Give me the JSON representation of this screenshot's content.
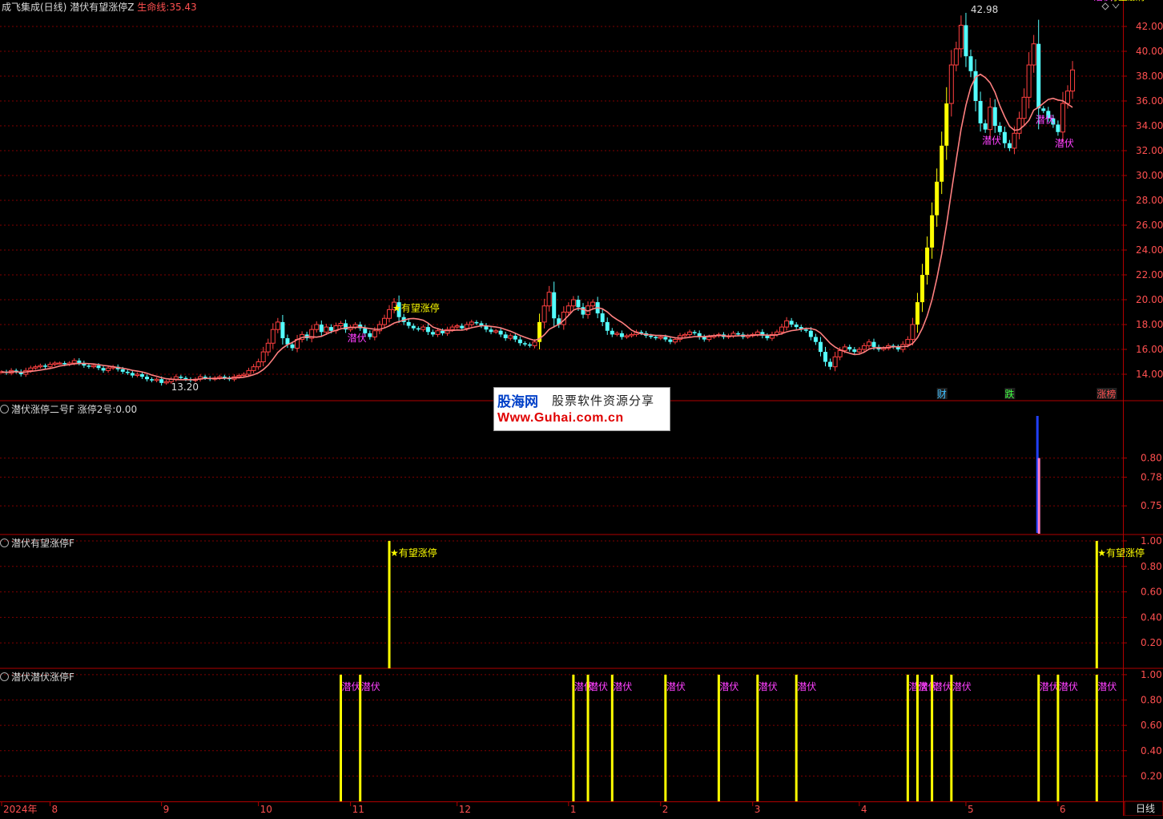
{
  "panel1": {
    "title": "成飞集成(日线)",
    "indicator": "潜伏有望涨停Z",
    "line_label": "生命线:",
    "line_value": "35.43",
    "high_label": "42.98",
    "low_label": "13.20",
    "signal_star": "有望涨停",
    "signal_latent": "潜伏",
    "mark_cai": "财",
    "mark_die": "跌",
    "mark_zhangbang": "涨榜"
  },
  "panel2": {
    "title": "潜伏涨停二号F",
    "value_label": "涨停2号:",
    "value": "0.00"
  },
  "panel3": {
    "title": "潜伏有望涨停F",
    "signal": "有望涨停"
  },
  "panel4": {
    "title": "潜伏潜伏涨停F",
    "signal": "潜伏"
  },
  "xaxis": {
    "labels": [
      "2024年",
      "8",
      "9",
      "10",
      "11",
      "12",
      "1",
      "2",
      "3",
      "4",
      "5",
      "6"
    ]
  },
  "period_label": "日线",
  "watermark": {
    "brand": "股海网",
    "slogan": "股票软件资源分享",
    "url": "Www.Guhai.com.cn"
  },
  "colors": {
    "up": "#ff4040",
    "down": "#54ffff",
    "signal": "#ffff00",
    "latent": "#ff40ff",
    "lifeline": "#ff8080",
    "grid": "#800000"
  },
  "chart_data": [
    {
      "type": "line",
      "name": "price",
      "ylim": [
        13,
        43
      ],
      "yticks": [
        "14.00",
        "16.00",
        "18.00",
        "20.00",
        "22.00",
        "24.00",
        "26.00",
        "28.00",
        "30.00",
        "32.00",
        "34.00",
        "36.00",
        "38.00",
        "40.00",
        "42.00"
      ],
      "close": [
        14.2,
        14.1,
        14.3,
        14.2,
        14.0,
        14.3,
        14.5,
        14.6,
        14.7,
        14.6,
        14.8,
        14.9,
        14.9,
        14.8,
        14.9,
        15.1,
        14.9,
        14.7,
        14.6,
        14.7,
        14.5,
        14.3,
        14.5,
        14.6,
        14.4,
        14.2,
        14.1,
        13.9,
        14.0,
        13.8,
        13.6,
        13.5,
        13.6,
        13.3,
        13.4,
        13.6,
        13.8,
        13.7,
        13.6,
        13.5,
        13.6,
        13.8,
        13.7,
        13.6,
        13.7,
        13.8,
        13.7,
        13.6,
        13.8,
        13.9,
        14.0,
        14.3,
        14.6,
        15.0,
        15.8,
        16.5,
        17.6,
        18.2,
        16.9,
        16.4,
        16.1,
        16.8,
        17.2,
        16.9,
        17.6,
        18.0,
        17.4,
        17.8,
        17.5,
        17.9,
        18.1,
        17.6,
        17.8,
        18.0,
        17.7,
        17.3,
        17.0,
        17.5,
        18.0,
        18.5,
        19.2,
        19.8,
        18.6,
        18.2,
        17.9,
        17.7,
        17.6,
        17.8,
        17.4,
        17.2,
        17.5,
        17.3,
        17.6,
        17.8,
        17.9,
        17.7,
        18.0,
        18.2,
        18.1,
        17.9,
        17.6,
        17.4,
        17.5,
        17.2,
        16.9,
        17.1,
        16.8,
        16.5,
        16.4,
        16.3,
        16.6,
        18.2,
        19.5,
        20.6,
        18.5,
        18.0,
        19.0,
        19.5,
        20.0,
        19.4,
        18.8,
        19.5,
        19.8,
        18.9,
        18.2,
        17.5,
        17.2,
        17.3,
        17.0,
        17.1,
        17.2,
        17.4,
        17.3,
        17.1,
        17.0,
        16.9,
        17.0,
        16.8,
        16.6,
        16.8,
        17.1,
        17.2,
        17.4,
        17.3,
        17.0,
        16.8,
        17.0,
        17.1,
        17.2,
        17.0,
        17.1,
        17.3,
        17.2,
        17.0,
        17.1,
        17.2,
        17.4,
        17.1,
        16.9,
        17.2,
        17.4,
        17.8,
        18.3,
        18.0,
        17.8,
        17.6,
        17.5,
        17.0,
        16.6,
        15.8,
        15.0,
        14.6,
        15.4,
        15.9,
        16.2,
        16.0,
        15.8,
        16.0,
        16.3,
        16.6,
        16.2,
        16.0,
        16.1,
        16.3,
        16.2,
        16.0,
        16.4,
        16.8,
        18.0,
        19.8,
        22.0,
        24.2,
        26.8,
        29.5,
        32.4,
        35.8,
        38.9,
        40.2,
        42.1,
        39.6,
        38.4,
        36.0,
        34.2,
        33.7,
        35.5,
        34.0,
        33.5,
        32.6,
        32.2,
        33.4,
        34.6,
        36.3,
        38.9,
        40.6,
        35.4,
        35.2,
        34.6,
        34.1,
        33.5,
        35.8,
        36.8,
        38.5
      ]
    },
    {
      "type": "bar",
      "name": "涨停2号",
      "ylim": [
        0.72,
        0.86
      ],
      "yticks": [
        "0.75",
        "0.78",
        "0.80"
      ],
      "x": [
        214
      ],
      "values": [
        0.8
      ]
    },
    {
      "type": "bar",
      "name": "有望涨停",
      "ylim": [
        0,
        1.05
      ],
      "yticks": [
        "0.20",
        "0.40",
        "0.60",
        "0.80",
        "1.00"
      ],
      "x": [
        80,
        226
      ],
      "values": [
        1.0,
        1.0
      ]
    },
    {
      "type": "bar",
      "name": "潜伏",
      "ylim": [
        0,
        1.05
      ],
      "yticks": [
        "0.20",
        "0.40",
        "0.60",
        "0.80",
        "1.00"
      ],
      "x": [
        70,
        74,
        118,
        121,
        126,
        137,
        148,
        156,
        164,
        187,
        189,
        192,
        196,
        214,
        218,
        226
      ],
      "values": [
        1,
        1,
        1,
        1,
        1,
        1,
        1,
        1,
        1,
        1,
        1,
        1,
        1,
        1,
        1,
        1
      ]
    }
  ]
}
